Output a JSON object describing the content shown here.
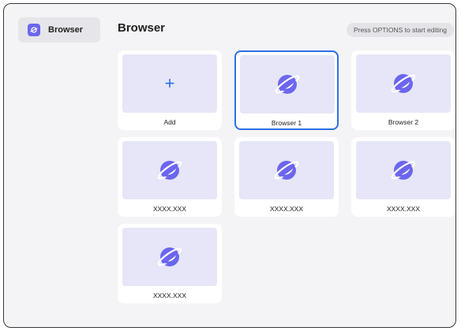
{
  "sidebar": {
    "items": [
      {
        "label": "Browser",
        "icon": "browser-icon",
        "selected": true
      }
    ]
  },
  "header": {
    "title": "Browser",
    "hint": "Press OPTIONS to start editing"
  },
  "tiles": [
    {
      "label": "Add",
      "icon": "plus-icon"
    },
    {
      "label": "Browser 1",
      "icon": "planet-icon",
      "focused": true
    },
    {
      "label": "Browser 2",
      "icon": "planet-icon"
    },
    {
      "label": "XXXX.XXX",
      "icon": "planet-icon"
    },
    {
      "label": "XXXX.XXX",
      "icon": "planet-icon"
    },
    {
      "label": "XXXX.XXX",
      "icon": "planet-icon"
    },
    {
      "label": "XXXX.XXX",
      "icon": "planet-icon"
    }
  ],
  "colors": {
    "accent": "#2b6fe6",
    "planet": "#6c66ee",
    "thumb_bg": "#e6e6f8"
  }
}
